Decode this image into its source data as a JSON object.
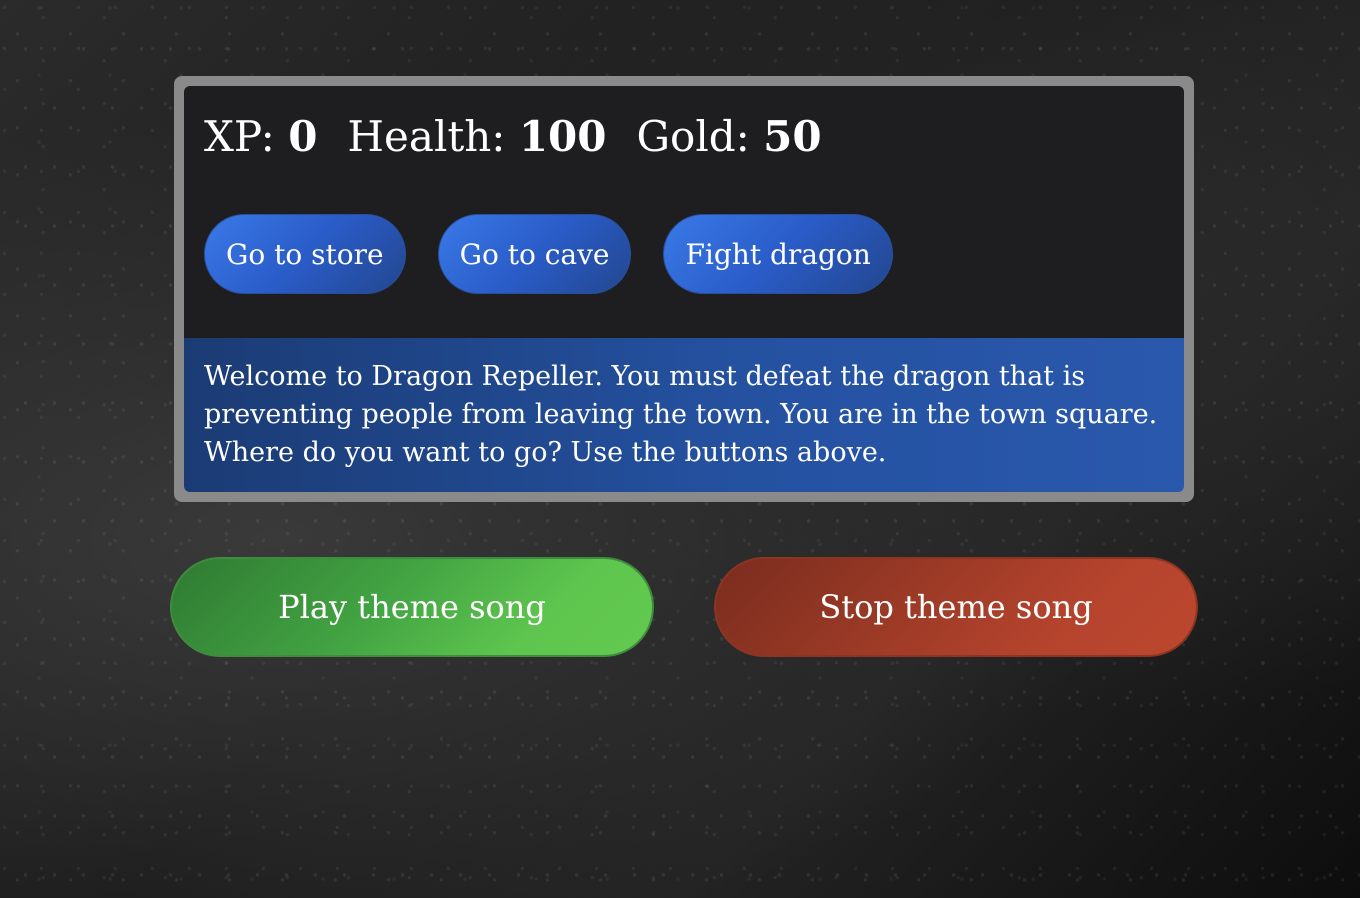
{
  "stats": {
    "xp_label": "XP:",
    "xp_value": "0",
    "health_label": "Health:",
    "health_value": "100",
    "gold_label": "Gold:",
    "gold_value": "50"
  },
  "controls": {
    "store_label": "Go to store",
    "cave_label": "Go to cave",
    "dragon_label": "Fight dragon"
  },
  "text": {
    "message": "Welcome to Dragon Repeller. You must defeat the dragon that is preventing people from leaving the town. You are in the town square. Where do you want to go? Use the buttons above."
  },
  "music": {
    "play_label": "Play theme song",
    "stop_label": "Stop theme song"
  },
  "colors": {
    "nav_button": "#2a5cc8",
    "text_panel": "#2451a0",
    "play_button": "#43a543",
    "stop_button": "#b4432d",
    "frame": "#8a8a8a",
    "stats_panel": "#1e1e21"
  }
}
